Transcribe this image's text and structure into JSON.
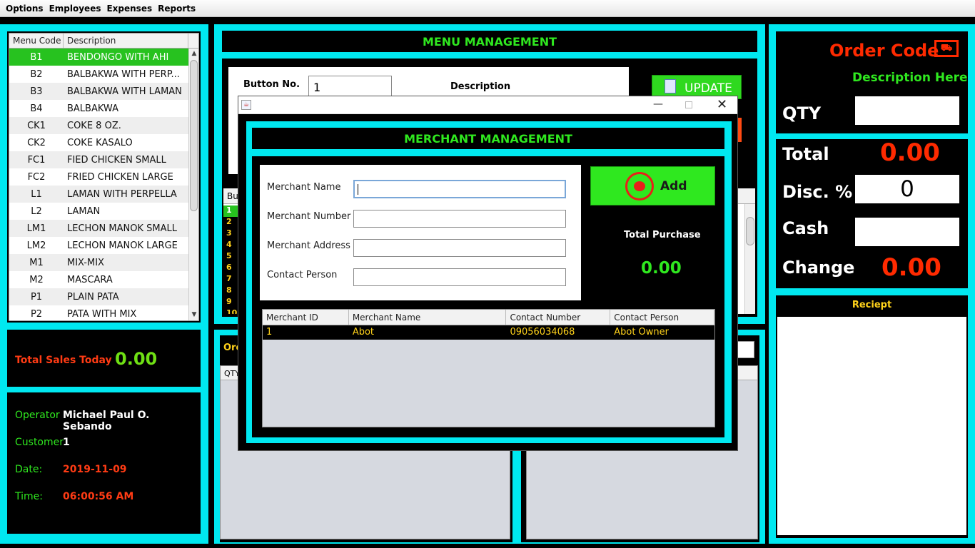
{
  "menubar": {
    "items": [
      "Options",
      "Employees",
      "Expenses",
      "Reports"
    ]
  },
  "menu_list": {
    "columns": [
      "Menu Code",
      "Description"
    ],
    "rows": [
      {
        "code": "B1",
        "desc": "BENDONGO WITH AHI"
      },
      {
        "code": "B2",
        "desc": "BALBAKWA WITH PERP..."
      },
      {
        "code": "B3",
        "desc": "BALBAKWA WITH LAMAN"
      },
      {
        "code": "B4",
        "desc": "BALBAKWA"
      },
      {
        "code": "CK1",
        "desc": "COKE 8 OZ."
      },
      {
        "code": "CK2",
        "desc": "COKE  KASALO"
      },
      {
        "code": "FC1",
        "desc": "FIED CHICKEN SMALL"
      },
      {
        "code": "FC2",
        "desc": "FRIED CHICKEN LARGE"
      },
      {
        "code": "L1",
        "desc": "LAMAN WITH PERPELLA"
      },
      {
        "code": "L2",
        "desc": "LAMAN"
      },
      {
        "code": "LM1",
        "desc": "LECHON MANOK SMALL"
      },
      {
        "code": "LM2",
        "desc": "LECHON MANOK LARGE"
      },
      {
        "code": "M1",
        "desc": "MIX-MIX"
      },
      {
        "code": "M2",
        "desc": "MASCARA"
      },
      {
        "code": "P1",
        "desc": "PLAIN PATA"
      },
      {
        "code": "P2",
        "desc": "PATA WITH MIX"
      }
    ]
  },
  "sales": {
    "label": "Total Sales Today",
    "value": "0.00"
  },
  "info": {
    "operator_label": "Operator",
    "operator": "Michael Paul O. Sebando",
    "customer_label": "Customer",
    "customer": "1",
    "date_label": "Date:",
    "date": "2019-11-09",
    "time_label": "Time:",
    "time": "06:00:56 AM"
  },
  "menu_mgmt": {
    "title": "MENU MANAGEMENT",
    "button_no_label": "Button No.",
    "button_no_value": "1",
    "description_label": "Description",
    "update_label": "UPDATE",
    "list_header": "Bu",
    "list_numbers": [
      "1",
      "2",
      "3",
      "4",
      "5",
      "6",
      "7",
      "8",
      "9",
      "10"
    ]
  },
  "order_panel": {
    "header": "Orc",
    "qty_col": "QTY"
  },
  "right_panel": {
    "order_code": "Order Code",
    "description": "Description Here",
    "qty_label": "QTY",
    "total_label": "Total",
    "total_value": "0.00",
    "disc_label": "Disc. %",
    "disc_value": "0",
    "cash_label": "Cash",
    "change_label": "Change",
    "change_value": "0.00",
    "receipt_label": "Reciept"
  },
  "dialog": {
    "title": "MERCHANT MANAGEMENT",
    "fields": [
      {
        "label": "Merchant Name",
        "value": ""
      },
      {
        "label": "Merchant Number",
        "value": ""
      },
      {
        "label": "Merchant Address",
        "value": ""
      },
      {
        "label": "Contact Person",
        "value": ""
      }
    ],
    "add_label": "Add",
    "total_purchase_label": "Total Purchase",
    "total_purchase_value": "0.00",
    "table": {
      "columns": [
        "Merchant ID",
        "Merchant Name",
        "Contact Number",
        "Contact Person"
      ],
      "rows": [
        {
          "id": "1",
          "name": "Abot",
          "number": "09056034068",
          "person": "Abot Owner"
        }
      ]
    }
  },
  "colors": {
    "cyan": "#00e8f0",
    "green": "#2fe81f",
    "red": "#ff2a00",
    "yellow": "#ffd21a"
  }
}
